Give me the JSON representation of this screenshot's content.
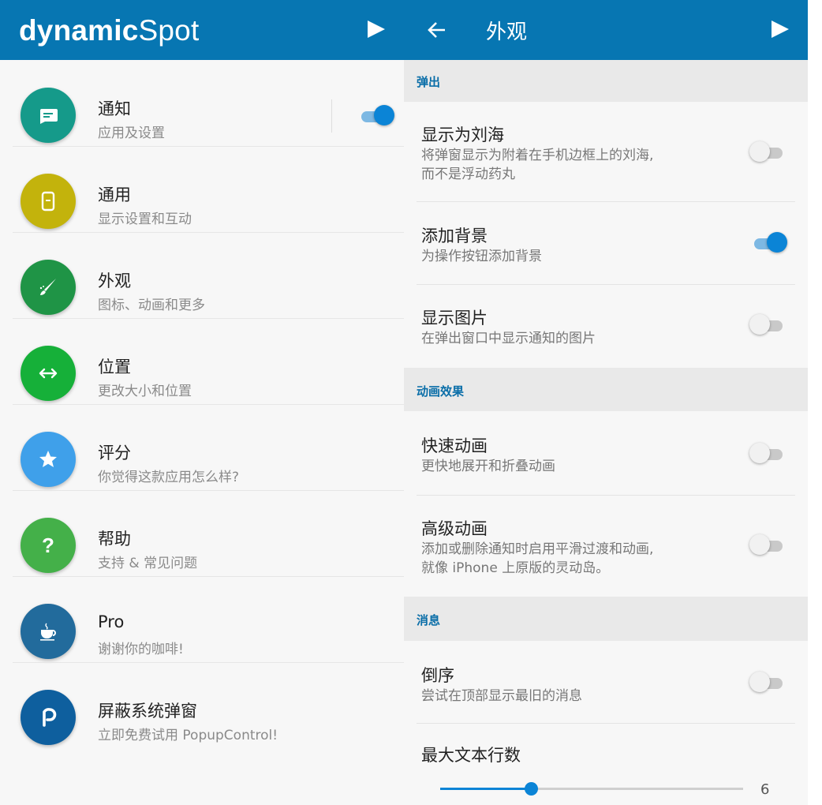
{
  "left": {
    "app_title_bold": "dynamic",
    "app_title_light": "Spot",
    "play_icon": "play-icon",
    "items": [
      {
        "label": "通知",
        "sub": "应用及设置",
        "color": "#159a8a",
        "icon": "chat-bubble-icon",
        "toggle": true
      },
      {
        "label": "通用",
        "sub": "显示设置和互动",
        "color": "#c3b30c",
        "icon": "phone-outline-icon"
      },
      {
        "label": "外观",
        "sub": "图标、动画和更多",
        "color": "#1f9446",
        "icon": "paint-brush-icon"
      },
      {
        "label": "位置",
        "sub": "更改大小和位置",
        "color": "#16b039",
        "icon": "horizontal-arrows-icon"
      },
      {
        "label": "评分",
        "sub": "你觉得这款应用怎么样?",
        "color": "#3fa0ea",
        "icon": "star-icon"
      },
      {
        "label": "帮助",
        "sub": "支持 & 常见问题",
        "color": "#44b049",
        "icon": "question-mark-icon"
      },
      {
        "label": "Pro",
        "sub": "谢谢你的咖啡!",
        "color": "#226b9c",
        "icon": "coffee-cup-icon"
      },
      {
        "label": "屏蔽系统弹窗",
        "sub": "立即免费试用 PopupControl!",
        "color": "#0e5f9e",
        "icon": "popupcontrol-logo-icon"
      }
    ]
  },
  "right": {
    "title": "外观",
    "sections": {
      "popup": "弹出",
      "animation": "动画效果",
      "messages": "消息"
    },
    "settings": {
      "notch": {
        "title": "显示为刘海",
        "desc_line1": "将弹窗显示为附着在手机边框上的刘海,",
        "desc_line2": "而不是浮动药丸",
        "on": false
      },
      "background": {
        "title": "添加背景",
        "desc": "为操作按钮添加背景",
        "on": true
      },
      "image": {
        "title": "显示图片",
        "desc": "在弹出窗口中显示通知的图片",
        "on": false
      },
      "fast_anim": {
        "title": "快速动画",
        "desc": "更快地展开和折叠动画",
        "on": false
      },
      "adv_anim": {
        "title": "高级动画",
        "desc_line1": "添加或删除通知时启用平滑过渡和动画,",
        "desc_line2": "就像 iPhone 上原版的灵动岛。",
        "on": false
      },
      "reverse": {
        "title": "倒序",
        "desc": "尝试在顶部显示最旧的消息",
        "on": false
      },
      "max_lines": {
        "title": "最大文本行数",
        "value": "6",
        "fraction": 0.3
      }
    }
  },
  "colors": {
    "appbar": "#0776b2",
    "accent": "#0b84d6",
    "section_text": "#0a6ea8"
  }
}
